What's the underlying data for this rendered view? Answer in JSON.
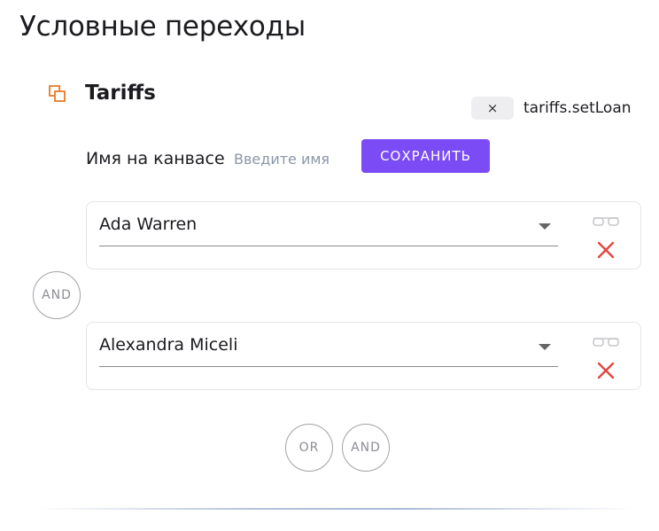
{
  "page": {
    "title": "Условные переходы"
  },
  "node": {
    "icon": "copy-squares-icon",
    "title": "Tariffs",
    "remove_symbol": "×",
    "method": "tariffs.setLoan"
  },
  "canvas_name": {
    "label": "Имя на канвасе",
    "placeholder": "Введите имя",
    "value": "",
    "save_label": "СОХРАНИТЬ"
  },
  "conditions": [
    {
      "value": "Ada Warren"
    },
    {
      "value": "Alexandra Miceli"
    }
  ],
  "connector": {
    "label": "AND"
  },
  "actions": {
    "or_label": "OR",
    "and_label": "AND"
  },
  "colors": {
    "accent": "#7b4cf5",
    "icon_orange": "#e87a2a",
    "delete_red": "#e0473f"
  }
}
